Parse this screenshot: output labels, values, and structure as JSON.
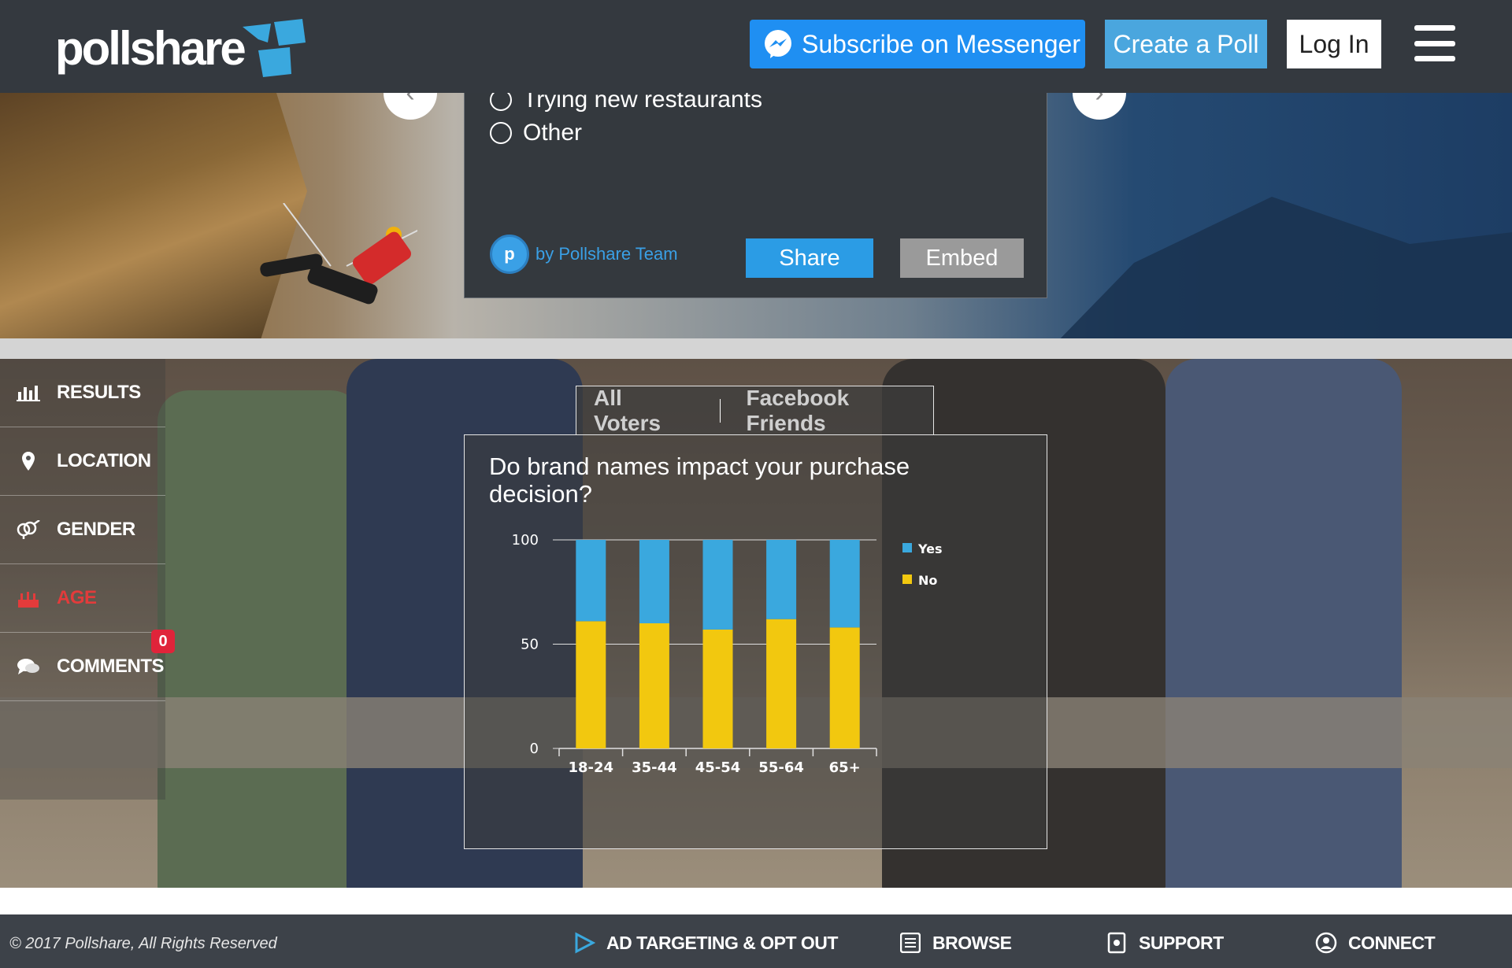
{
  "header": {
    "logo_text": "pollshare",
    "messenger_label": "Subscribe on Messenger",
    "create_label": "Create a Poll",
    "login_label": "Log In"
  },
  "poll": {
    "options": [
      "Trying new restaurants",
      "Other"
    ],
    "author": "by Pollshare Team",
    "avatar_letter": "p",
    "share_label": "Share",
    "embed_label": "Embed"
  },
  "sidebar": {
    "items": [
      {
        "label": "RESULTS",
        "icon": "bar-chart-icon"
      },
      {
        "label": "LOCATION",
        "icon": "map-pin-icon"
      },
      {
        "label": "GENDER",
        "icon": "gender-icon"
      },
      {
        "label": "AGE",
        "icon": "age-icon"
      },
      {
        "label": "COMMENTS",
        "icon": "comments-icon"
      }
    ],
    "comments_count": "0"
  },
  "tabs": {
    "all_voters": "All Voters",
    "facebook_friends": "Facebook Friends"
  },
  "chart_data": {
    "type": "bar",
    "stacked": true,
    "title": "Do brand names impact your purchase decision?",
    "categories": [
      "18-24",
      "35-44",
      "45-54",
      "55-64",
      "65+"
    ],
    "series": [
      {
        "name": "Yes",
        "color": "#3aa8de",
        "values": [
          39,
          40,
          43,
          38,
          42
        ]
      },
      {
        "name": "No",
        "color": "#f2c80f",
        "values": [
          61,
          60,
          57,
          62,
          58
        ]
      }
    ],
    "yticks": [
      "0",
      "50",
      "100"
    ],
    "ylim": [
      0,
      100
    ],
    "legend": "right"
  },
  "footer": {
    "copyright": "© 2017 Pollshare, All Rights Reserved",
    "links": [
      "AD TARGETING & OPT OUT",
      "BROWSE",
      "SUPPORT",
      "CONNECT"
    ]
  },
  "colors": {
    "header_bg": "#34393f",
    "accent_blue": "#2b9ce5",
    "active_red": "#e33b3b",
    "yes": "#3aa8de",
    "no": "#f2c80f"
  }
}
